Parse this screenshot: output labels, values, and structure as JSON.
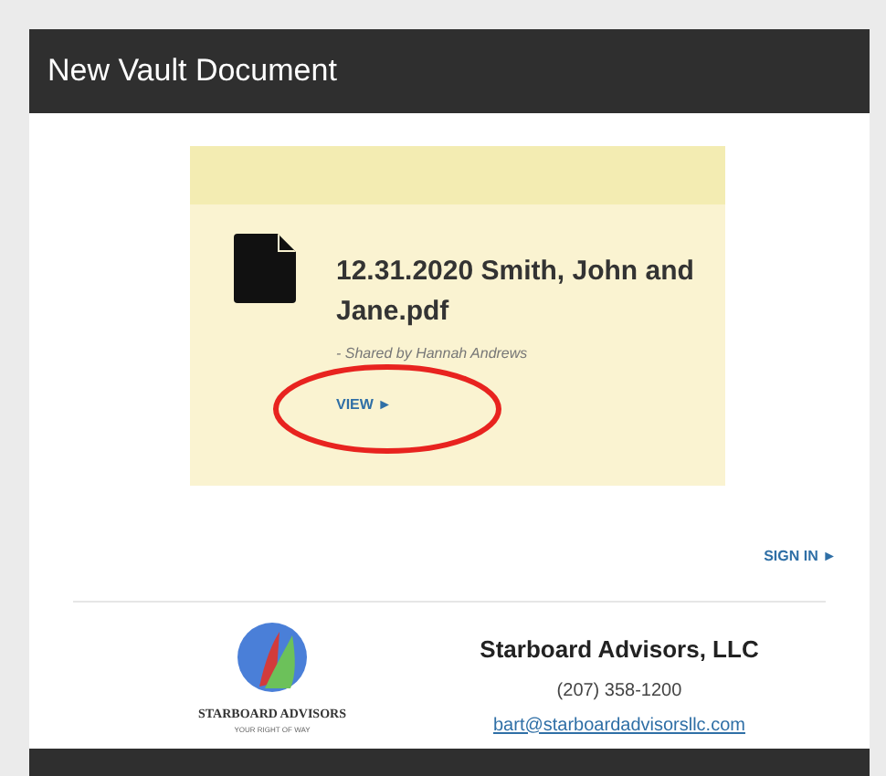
{
  "header": {
    "title": "New Vault Document"
  },
  "document": {
    "name": "12.31.2020 Smith, John and Jane.pdf",
    "shared_by": "*- Shared by Hannah Andrews*",
    "view_link": "VIEW ►",
    "annotation": {
      "kind": "ellipse",
      "color": "#e8231f"
    }
  },
  "sign_in_link": "SIGN IN ►",
  "footer": {
    "logo_name": "STARBOARD ADVISORS",
    "logo_tagline": "YOUR RIGHT OF WAY",
    "company": "Starboard Advisors, LLC",
    "phone": "(207) 358-1200",
    "email": "bart@starboardadvisorsllc.com"
  }
}
